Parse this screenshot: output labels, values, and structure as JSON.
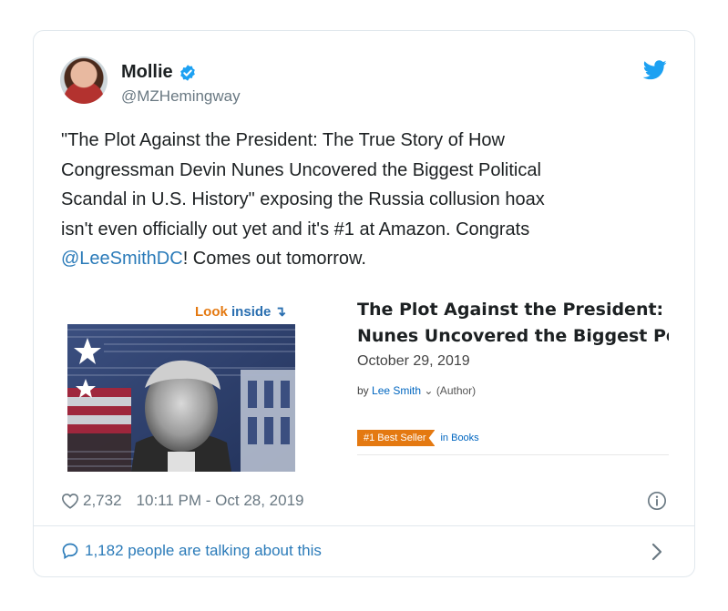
{
  "author": {
    "display_name": "Mollie",
    "handle": "@MZHemingway"
  },
  "tweet": {
    "text_lines": [
      "\"The Plot Against the President: The True Story of How",
      "Congressman Devin Nunes Uncovered the Biggest Political",
      "Scandal in U.S. History\" exposing the Russia collusion hoax",
      "isn't even officially out yet and it's #1 at Amazon. Congrats"
    ],
    "mention": "@LeeSmithDC",
    "text_tail": "! Comes out tomorrow."
  },
  "book": {
    "look_inside_1": "Look",
    "look_inside_2": "inside",
    "look_inside_arrow": "↴",
    "title_line1": "The Plot Against the President: The True Story of How Congressman Devin",
    "title_line2": "Nunes Uncovered the Biggest Political Scandal in U.S. History",
    "date": "October 29, 2019",
    "by": "by",
    "author": "Lee Smith",
    "author_chevron": "⌄",
    "role": "(Author)",
    "badge": "#1 Best Seller",
    "badge_category": "in Books"
  },
  "meta": {
    "likes": "2,732",
    "timestamp": "10:11 PM - Oct 28, 2019"
  },
  "conversation": {
    "label": "1,182 people are talking about this"
  },
  "icons": {
    "verified": "verified-badge-icon",
    "bird": "twitter-bird-icon",
    "heart": "heart-icon",
    "info": "info-icon",
    "bubble": "comment-bubble-icon",
    "chevron": "chevron-right-icon"
  },
  "colors": {
    "link": "#2b7bb9",
    "twitter_blue": "#1da1f2",
    "amazon_orange": "#e47911",
    "amazon_link": "#0066c0",
    "muted": "#697882"
  }
}
